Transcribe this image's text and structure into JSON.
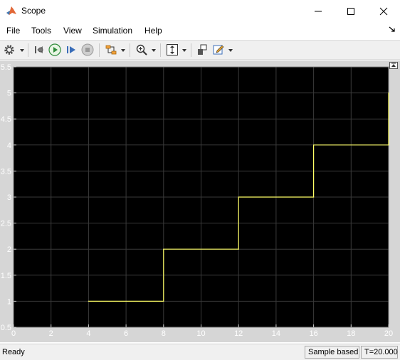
{
  "window": {
    "title": "Scope",
    "app_icon": "matlab-icon",
    "controls": [
      "minimize-icon",
      "maximize-icon",
      "close-icon"
    ]
  },
  "menu": {
    "items": [
      "File",
      "Tools",
      "View",
      "Simulation",
      "Help"
    ]
  },
  "toolbar": {
    "icons": [
      "gear-icon",
      "step-back-icon",
      "run-icon",
      "step-forward-icon",
      "stop-icon",
      "signal-select-icon",
      "zoom-icon",
      "scale-axes-icon",
      "highlight-block-icon",
      "edit-icon"
    ]
  },
  "statusbar": {
    "status": "Ready",
    "mode": "Sample based",
    "time": "T=20.000"
  },
  "colors": {
    "plot_background": "#000000",
    "axes_frame": "#d6d6d6",
    "grid": "#3a3a3a",
    "signal": "#ffff66",
    "tick_text": "#ffffff"
  },
  "chart_data": {
    "type": "line",
    "step": true,
    "title": "",
    "xlabel": "",
    "ylabel": "",
    "xlim": [
      0,
      20
    ],
    "ylim": [
      0.5,
      5.5
    ],
    "grid": true,
    "xticks": [
      "0",
      "2",
      "4",
      "6",
      "8",
      "10",
      "12",
      "14",
      "16",
      "18",
      "20"
    ],
    "yticks": [
      "0.5",
      "1",
      "1.5",
      "2",
      "2.5",
      "3",
      "3.5",
      "4",
      "4.5",
      "5",
      "5.5"
    ],
    "series": [
      {
        "color": "#ffff66",
        "x": [
          4,
          8,
          8,
          12,
          12,
          16,
          16,
          20,
          20
        ],
        "y": [
          1,
          1,
          2,
          2,
          3,
          3,
          4,
          4,
          5
        ]
      }
    ]
  }
}
